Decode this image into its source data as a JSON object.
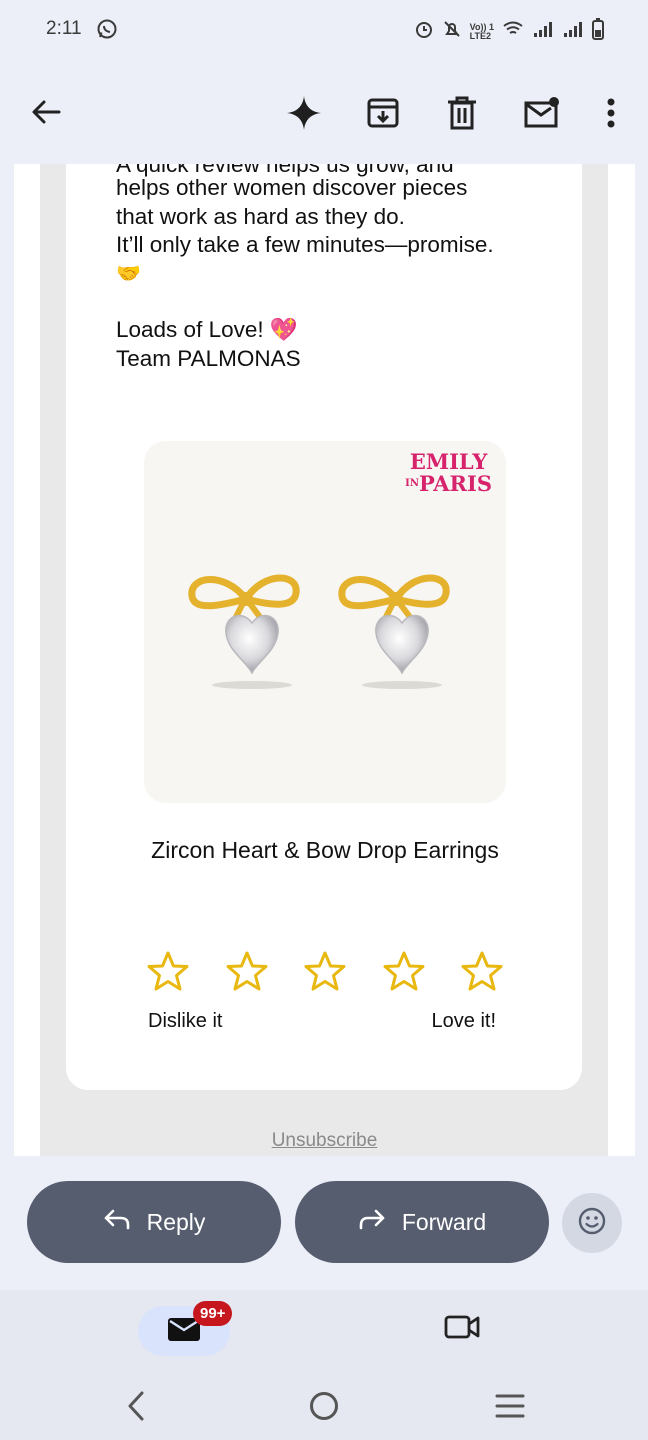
{
  "status_bar": {
    "time": "2:11",
    "network_label_top": "Vo)) 1",
    "network_label_bottom": "LTE2"
  },
  "app_bar": {
    "icons": [
      "back-arrow-icon",
      "gemini-sparkle-icon",
      "archive-icon",
      "delete-icon",
      "mark-unread-icon",
      "more-vert-icon"
    ]
  },
  "email": {
    "cut_line": "A quick review helps us grow, and",
    "body_lines": [
      "helps other women discover pieces",
      "that work as hard as they do.",
      "It’ll only take a few minutes—promise.",
      "🤝"
    ],
    "signoff": "Loads of Love! 💖",
    "team": "Team PALMONAS",
    "product": {
      "brand_line1": "EMILY",
      "brand_line2_small": "IN",
      "brand_line2": "PARIS",
      "title": "Zircon Heart & Bow Drop Earrings"
    },
    "rating": {
      "stars": 5,
      "selected": 0,
      "low_label": "Dislike it",
      "high_label": "Love it!"
    },
    "unsubscribe": "Unsubscribe"
  },
  "actions": {
    "reply_label": "Reply",
    "forward_label": "Forward"
  },
  "bottom_nav": {
    "mail_badge": "99+"
  },
  "colors": {
    "background": "#eceff8",
    "button": "#555d6f",
    "star": "#e8b80f",
    "badge": "#c7171e",
    "brand_pink": "#d6236b",
    "gold": "#e5b22e"
  }
}
